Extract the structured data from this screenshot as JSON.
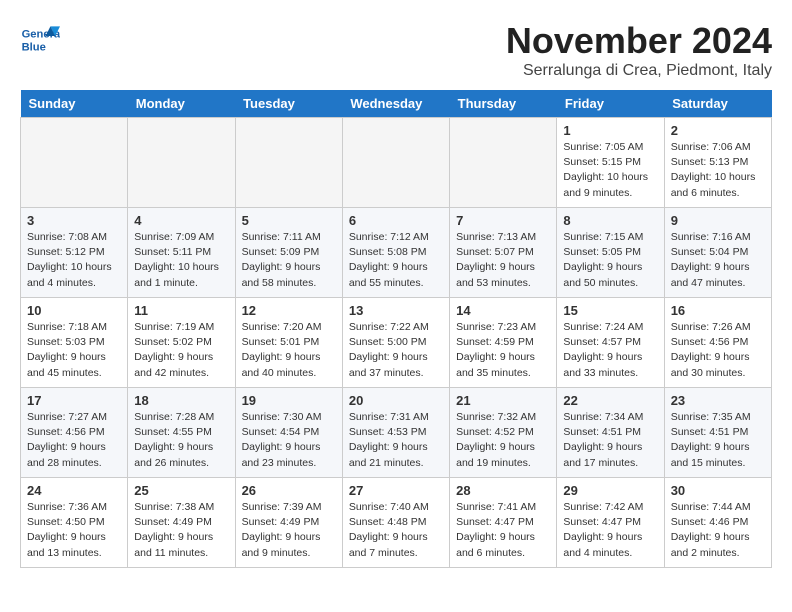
{
  "logo": {
    "text_general": "General",
    "text_blue": "Blue"
  },
  "title": "November 2024",
  "location": "Serralunga di Crea, Piedmont, Italy",
  "headers": [
    "Sunday",
    "Monday",
    "Tuesday",
    "Wednesday",
    "Thursday",
    "Friday",
    "Saturday"
  ],
  "weeks": [
    {
      "days": [
        {
          "num": "",
          "info": "",
          "empty": true
        },
        {
          "num": "",
          "info": "",
          "empty": true
        },
        {
          "num": "",
          "info": "",
          "empty": true
        },
        {
          "num": "",
          "info": "",
          "empty": true
        },
        {
          "num": "",
          "info": "",
          "empty": true
        },
        {
          "num": "1",
          "info": "Sunrise: 7:05 AM\nSunset: 5:15 PM\nDaylight: 10 hours\nand 9 minutes.",
          "empty": false
        },
        {
          "num": "2",
          "info": "Sunrise: 7:06 AM\nSunset: 5:13 PM\nDaylight: 10 hours\nand 6 minutes.",
          "empty": false
        }
      ]
    },
    {
      "days": [
        {
          "num": "3",
          "info": "Sunrise: 7:08 AM\nSunset: 5:12 PM\nDaylight: 10 hours\nand 4 minutes.",
          "empty": false
        },
        {
          "num": "4",
          "info": "Sunrise: 7:09 AM\nSunset: 5:11 PM\nDaylight: 10 hours\nand 1 minute.",
          "empty": false
        },
        {
          "num": "5",
          "info": "Sunrise: 7:11 AM\nSunset: 5:09 PM\nDaylight: 9 hours\nand 58 minutes.",
          "empty": false
        },
        {
          "num": "6",
          "info": "Sunrise: 7:12 AM\nSunset: 5:08 PM\nDaylight: 9 hours\nand 55 minutes.",
          "empty": false
        },
        {
          "num": "7",
          "info": "Sunrise: 7:13 AM\nSunset: 5:07 PM\nDaylight: 9 hours\nand 53 minutes.",
          "empty": false
        },
        {
          "num": "8",
          "info": "Sunrise: 7:15 AM\nSunset: 5:05 PM\nDaylight: 9 hours\nand 50 minutes.",
          "empty": false
        },
        {
          "num": "9",
          "info": "Sunrise: 7:16 AM\nSunset: 5:04 PM\nDaylight: 9 hours\nand 47 minutes.",
          "empty": false
        }
      ]
    },
    {
      "days": [
        {
          "num": "10",
          "info": "Sunrise: 7:18 AM\nSunset: 5:03 PM\nDaylight: 9 hours\nand 45 minutes.",
          "empty": false
        },
        {
          "num": "11",
          "info": "Sunrise: 7:19 AM\nSunset: 5:02 PM\nDaylight: 9 hours\nand 42 minutes.",
          "empty": false
        },
        {
          "num": "12",
          "info": "Sunrise: 7:20 AM\nSunset: 5:01 PM\nDaylight: 9 hours\nand 40 minutes.",
          "empty": false
        },
        {
          "num": "13",
          "info": "Sunrise: 7:22 AM\nSunset: 5:00 PM\nDaylight: 9 hours\nand 37 minutes.",
          "empty": false
        },
        {
          "num": "14",
          "info": "Sunrise: 7:23 AM\nSunset: 4:59 PM\nDaylight: 9 hours\nand 35 minutes.",
          "empty": false
        },
        {
          "num": "15",
          "info": "Sunrise: 7:24 AM\nSunset: 4:57 PM\nDaylight: 9 hours\nand 33 minutes.",
          "empty": false
        },
        {
          "num": "16",
          "info": "Sunrise: 7:26 AM\nSunset: 4:56 PM\nDaylight: 9 hours\nand 30 minutes.",
          "empty": false
        }
      ]
    },
    {
      "days": [
        {
          "num": "17",
          "info": "Sunrise: 7:27 AM\nSunset: 4:56 PM\nDaylight: 9 hours\nand 28 minutes.",
          "empty": false
        },
        {
          "num": "18",
          "info": "Sunrise: 7:28 AM\nSunset: 4:55 PM\nDaylight: 9 hours\nand 26 minutes.",
          "empty": false
        },
        {
          "num": "19",
          "info": "Sunrise: 7:30 AM\nSunset: 4:54 PM\nDaylight: 9 hours\nand 23 minutes.",
          "empty": false
        },
        {
          "num": "20",
          "info": "Sunrise: 7:31 AM\nSunset: 4:53 PM\nDaylight: 9 hours\nand 21 minutes.",
          "empty": false
        },
        {
          "num": "21",
          "info": "Sunrise: 7:32 AM\nSunset: 4:52 PM\nDaylight: 9 hours\nand 19 minutes.",
          "empty": false
        },
        {
          "num": "22",
          "info": "Sunrise: 7:34 AM\nSunset: 4:51 PM\nDaylight: 9 hours\nand 17 minutes.",
          "empty": false
        },
        {
          "num": "23",
          "info": "Sunrise: 7:35 AM\nSunset: 4:51 PM\nDaylight: 9 hours\nand 15 minutes.",
          "empty": false
        }
      ]
    },
    {
      "days": [
        {
          "num": "24",
          "info": "Sunrise: 7:36 AM\nSunset: 4:50 PM\nDaylight: 9 hours\nand 13 minutes.",
          "empty": false
        },
        {
          "num": "25",
          "info": "Sunrise: 7:38 AM\nSunset: 4:49 PM\nDaylight: 9 hours\nand 11 minutes.",
          "empty": false
        },
        {
          "num": "26",
          "info": "Sunrise: 7:39 AM\nSunset: 4:49 PM\nDaylight: 9 hours\nand 9 minutes.",
          "empty": false
        },
        {
          "num": "27",
          "info": "Sunrise: 7:40 AM\nSunset: 4:48 PM\nDaylight: 9 hours\nand 7 minutes.",
          "empty": false
        },
        {
          "num": "28",
          "info": "Sunrise: 7:41 AM\nSunset: 4:47 PM\nDaylight: 9 hours\nand 6 minutes.",
          "empty": false
        },
        {
          "num": "29",
          "info": "Sunrise: 7:42 AM\nSunset: 4:47 PM\nDaylight: 9 hours\nand 4 minutes.",
          "empty": false
        },
        {
          "num": "30",
          "info": "Sunrise: 7:44 AM\nSunset: 4:46 PM\nDaylight: 9 hours\nand 2 minutes.",
          "empty": false
        }
      ]
    }
  ]
}
